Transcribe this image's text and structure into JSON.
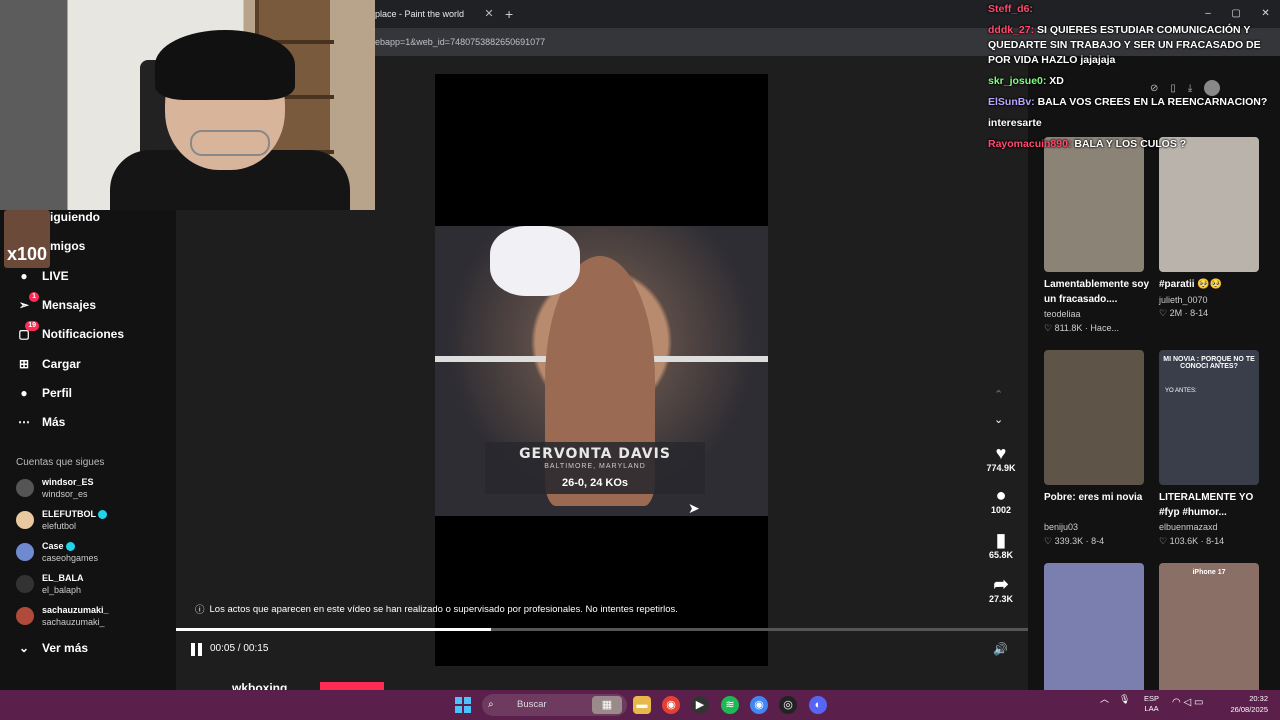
{
  "browser": {
    "tab_title": "place - Paint the world",
    "tab_close": "✕",
    "new_tab": "+",
    "url": "ebapp=1&web_id=7480753882650691077",
    "window_controls": [
      "–",
      "▢",
      "✕"
    ]
  },
  "stream_overlay": {
    "emote_label": "x100"
  },
  "sidebar": {
    "nav_items": [
      {
        "label": "iguiendo",
        "icon": "following-icon"
      },
      {
        "label": "migos",
        "icon": "friends-icon"
      },
      {
        "label": "LIVE",
        "icon": "live-icon"
      },
      {
        "label": "Mensajes",
        "icon": "messages-icon",
        "badge": "1"
      },
      {
        "label": "Notificaciones",
        "icon": "notifications-icon",
        "badge": "19"
      },
      {
        "label": "Cargar",
        "icon": "upload-icon"
      },
      {
        "label": "Perfil",
        "icon": "profile-icon"
      },
      {
        "label": "Más",
        "icon": "more-icon"
      }
    ],
    "following_title": "Cuentas que sigues",
    "accounts": [
      {
        "name": "windsor_ES",
        "handle": "windsor_es",
        "verified": false
      },
      {
        "name": "ELEFUTBOL",
        "handle": "elefutbol",
        "verified": true
      },
      {
        "name": "Case",
        "handle": "caseohgames",
        "verified": true
      },
      {
        "name": "EL_BALA",
        "handle": "el_balaph",
        "verified": false
      },
      {
        "name": "sachauzumaki_",
        "handle": "sachauzumaki_",
        "verified": false
      }
    ],
    "see_more": "Ver más"
  },
  "video": {
    "lower_third": {
      "name": "GERVONTA DAVIS",
      "place": "BALTIMORE, MARYLAND",
      "record": "26-0, 24 KOs"
    },
    "disclaimer": "Los actos que aparecen en este vídeo se han realizado o supervisado por profesionales. No intentes repetirlos.",
    "time": "00:05 / 00:15",
    "progress": 0.37,
    "author": "wkboxing"
  },
  "actions": {
    "likes": "774.9K",
    "comments": "1002",
    "saves": "65.8K",
    "shares": "27.3K"
  },
  "recommended": [
    {
      "title": "Lamentablemente soy un fracasado....",
      "user": "teodeliaa",
      "stats": "811.8K · Hace...",
      "color": "#8a8376"
    },
    {
      "title": "#paratii 🥺🥺",
      "user": "julieth_0070",
      "stats": "2M · 8-14",
      "color": "#b9b3ab"
    },
    {
      "title": "Pobre: eres mi novia",
      "user": "beniju03",
      "stats": "339.3K · 8-4",
      "color": "#5e5448",
      "caption": ""
    },
    {
      "title": "LITERALMENTE YO #fyp #humor...",
      "user": "elbuenmazaxd",
      "stats": "103.6K · 8-14",
      "color": "#3a3e4a",
      "caption": "MI NOVIA : PORQUE NO TE CONOCI ANTES?",
      "caption2": "YO ANTES:"
    },
    {
      "title": "",
      "user": "",
      "stats": "",
      "color": "#7a7fb0"
    },
    {
      "title": "",
      "user": "",
      "stats": "",
      "color": "#8a6f66",
      "caption": "iPhone 17"
    }
  ],
  "chat": [
    {
      "user": "Steff_d6:",
      "msg": "",
      "color": "red"
    },
    {
      "user": "dddk_27:",
      "msg": "SI QUIERES ESTUDIAR COMUNICACIÓN Y QUEDARTE SIN TRABAJO Y SER UN FRACASADO DE POR VIDA HAZLO jajajaja",
      "color": "red"
    },
    {
      "user": "skr_josue0:",
      "msg": "XD",
      "color": "green"
    },
    {
      "user": "ElSunBv:",
      "msg": "BALA VOS CREES EN LA REENCARNACION?",
      "color": "blue"
    },
    {
      "user": "",
      "msg": "interesarte",
      "color": "red"
    },
    {
      "user": "Rayomacuin890:",
      "msg": "BALA Y LOS CULOS ?",
      "color": "red"
    }
  ],
  "taskbar": {
    "search_placeholder": "Buscar",
    "lang_1": "ESP",
    "lang_2": "LAA",
    "time": "20:32",
    "date": "26/08/2025"
  },
  "colors": {
    "accent": "#fe2c55",
    "verified": "#20d5ec",
    "taskbar": "#5a1f4a"
  }
}
